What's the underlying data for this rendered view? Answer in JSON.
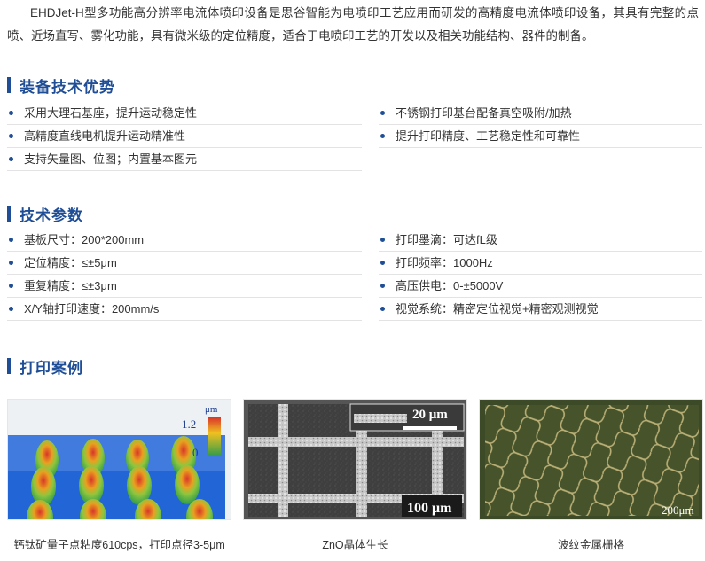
{
  "intro": "EHDJet-H型多功能高分辨率电流体喷印设备是思谷智能为电喷印工艺应用而研发的高精度电流体喷印设备，其具有完整的点喷、近场直写、雾化功能，具有微米级的定位精度，适合于电喷印工艺的开发以及相关功能结构、器件的制备。",
  "sections": {
    "advantages": {
      "title": "装备技术优势",
      "left": [
        "采用大理石基座，提升运动稳定性",
        "高精度直线电机提升运动精准性",
        "支持矢量图、位图；内置基本图元"
      ],
      "right": [
        "不锈钢打印基台配备真空吸附/加热",
        "提升打印精度、工艺稳定性和可靠性"
      ]
    },
    "params": {
      "title": "技术参数",
      "left": [
        "基板尺寸：200*200mm",
        "定位精度：≤±5μm",
        "重复精度：≤±3μm",
        "X/Y轴打印速度：200mm/s"
      ],
      "right": [
        "打印墨滴：可达fL级",
        "打印频率：1000Hz",
        "高压供电：0-±5000V",
        "视觉系统：精密定位视觉+精密观测视觉"
      ]
    },
    "cases": {
      "title": "打印案例",
      "items": [
        {
          "caption": "钙钛矿量子点粘度610cps，打印点径3-5μm",
          "scale_unit": "μm",
          "scale_max": "1.2",
          "scale_min": "0"
        },
        {
          "caption": "ZnO晶体生长",
          "scale_top": "20 μm",
          "scale_bottom": "100 μm"
        },
        {
          "caption": "波纹金属栅格",
          "scale": "200μm"
        }
      ]
    }
  },
  "colors": {
    "accent": "#1f4e96",
    "text": "#333333"
  }
}
